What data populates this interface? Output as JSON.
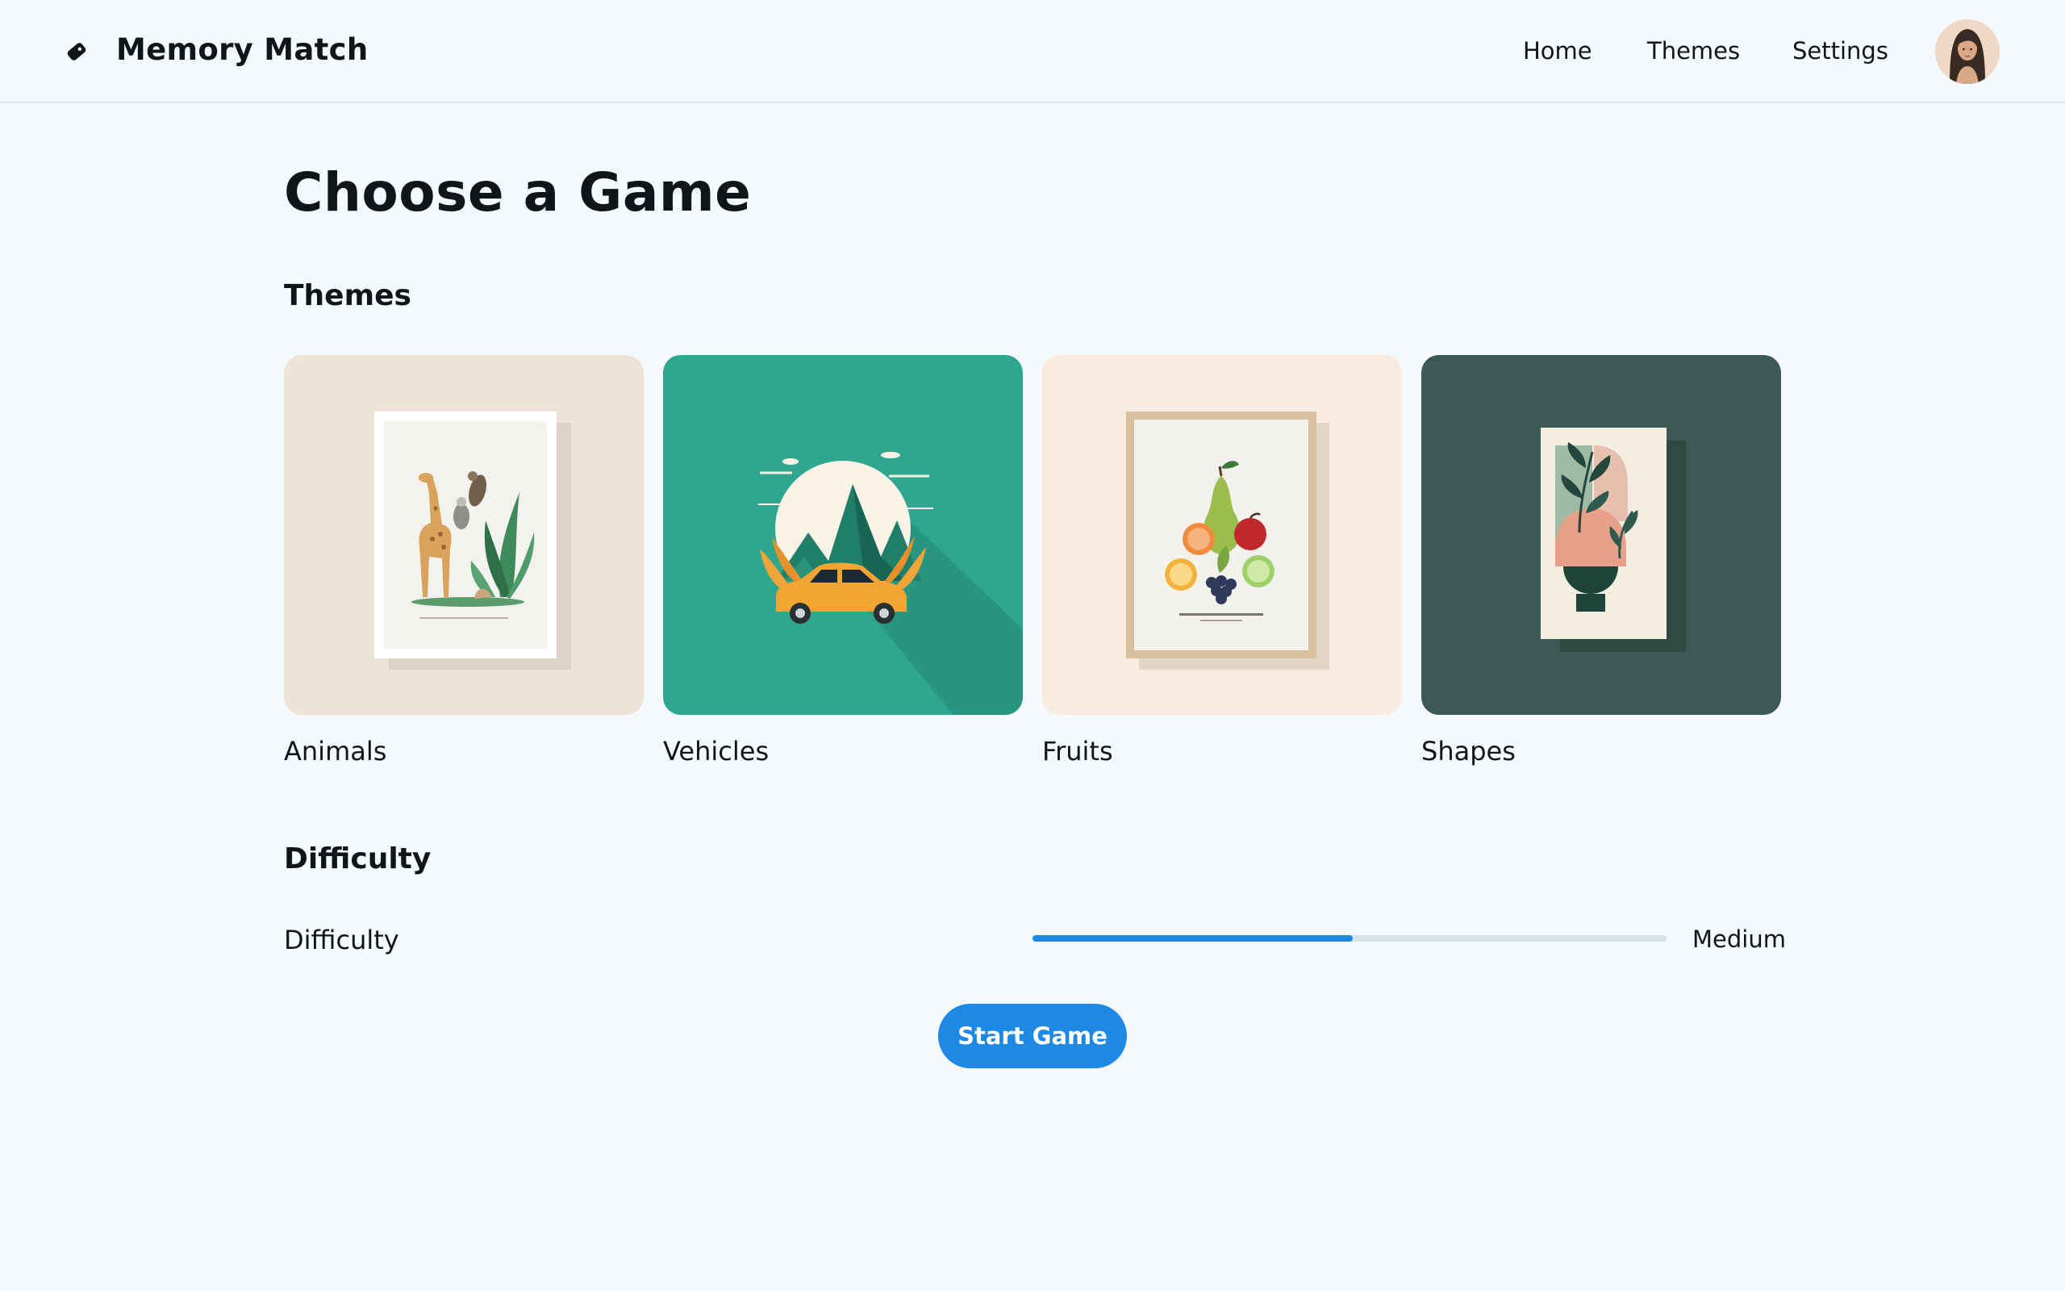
{
  "app": {
    "title": "Memory Match",
    "logo_icon": "tag-icon"
  },
  "nav": {
    "home": "Home",
    "themes": "Themes",
    "settings": "Settings"
  },
  "page": {
    "title": "Choose a Game"
  },
  "themes_section": {
    "title": "Themes",
    "cards": [
      {
        "label": "Animals",
        "image": "giraffe-bird-poster",
        "bg": "#ede3d9"
      },
      {
        "label": "Vehicles",
        "image": "car-mountain-illustration",
        "bg": "#2fa68f"
      },
      {
        "label": "Fruits",
        "image": "fruit-still-life-poster",
        "bg": "#f8ebe0"
      },
      {
        "label": "Shapes",
        "image": "botanical-shapes-poster",
        "bg": "#3c5a53"
      }
    ]
  },
  "difficulty_section": {
    "title": "Difficulty",
    "label": "Difficulty",
    "value_text": "Medium",
    "level_fraction": 0.505
  },
  "actions": {
    "start": "Start Game"
  },
  "colors": {
    "accent": "#1e88e5",
    "background": "#f6f9fc",
    "track": "#d8e0e8"
  }
}
